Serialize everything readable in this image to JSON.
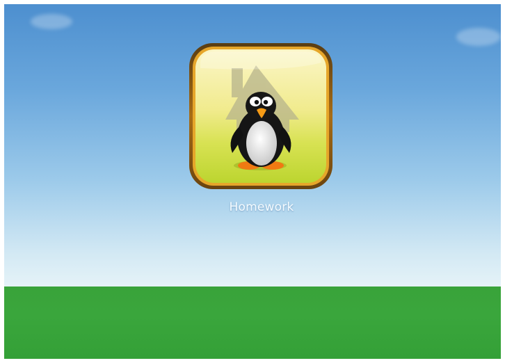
{
  "home_screen": {
    "apps": [
      {
        "label": "Homework",
        "icon": "penguin-house-icon"
      }
    ]
  },
  "colors": {
    "sky_top": "#4d8fcf",
    "sky_bottom": "#e6f3f8",
    "ground": "#39a33a",
    "icon_border": "#d89a1c",
    "icon_fill_top": "#fbf6c8",
    "icon_fill_bottom": "#c9dc3a"
  }
}
